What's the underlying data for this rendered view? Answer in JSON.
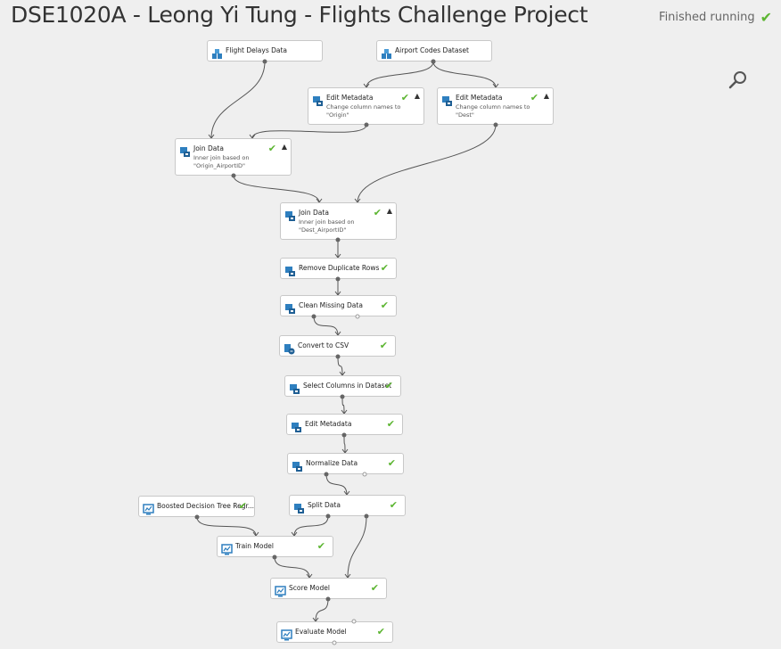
{
  "header": {
    "title": "DSE1020A - Leong Yi Tung - Flights Challenge Project",
    "status": "Finished running"
  },
  "modules": [
    {
      "id": "flight-delays-data",
      "label": "Flight Delays Data",
      "icon": "dataset-icon",
      "check": false
    },
    {
      "id": "airport-codes-dataset",
      "label": "Airport Codes Dataset",
      "icon": "dataset-icon",
      "check": false
    },
    {
      "id": "edit-metadata-origin",
      "label": "Edit Metadata",
      "desc": [
        "Change column names to",
        "\"Origin\""
      ],
      "icon": "module-icon",
      "check": true,
      "caret": true
    },
    {
      "id": "edit-metadata-dest",
      "label": "Edit Metadata",
      "desc": [
        "Change column names to",
        "\"Dest\""
      ],
      "icon": "module-icon",
      "check": true,
      "caret": true
    },
    {
      "id": "join-data-origin",
      "label": "Join Data",
      "desc": [
        "Inner join based on",
        "\"Origin_AirportID\""
      ],
      "icon": "module-icon",
      "check": true,
      "caret": true
    },
    {
      "id": "join-data-dest",
      "label": "Join Data",
      "desc": [
        "Inner join based on",
        "\"Dest_AirportID\""
      ],
      "icon": "module-icon",
      "check": true,
      "caret": true
    },
    {
      "id": "remove-duplicate-rows",
      "label": "Remove Duplicate Rows",
      "icon": "module-icon",
      "check": true
    },
    {
      "id": "clean-missing-data",
      "label": "Clean Missing Data",
      "icon": "module-icon",
      "check": true
    },
    {
      "id": "convert-to-csv",
      "label": "Convert to CSV",
      "icon": "convert-icon",
      "check": true
    },
    {
      "id": "select-columns",
      "label": "Select Columns in Dataset",
      "icon": "module-icon",
      "check": true
    },
    {
      "id": "edit-metadata-3",
      "label": "Edit Metadata",
      "icon": "module-icon",
      "check": true
    },
    {
      "id": "normalize-data",
      "label": "Normalize Data",
      "icon": "module-icon",
      "check": true
    },
    {
      "id": "boosted-decision-tree",
      "label": "Boosted Decision Tree Regr...",
      "icon": "model-icon",
      "check": true
    },
    {
      "id": "split-data",
      "label": "Split Data",
      "icon": "module-icon",
      "check": true
    },
    {
      "id": "train-model",
      "label": "Train Model",
      "icon": "model-icon",
      "check": true
    },
    {
      "id": "score-model",
      "label": "Score Model",
      "icon": "model-icon",
      "check": true
    },
    {
      "id": "evaluate-model",
      "label": "Evaluate Model",
      "icon": "model-icon",
      "check": true
    }
  ]
}
